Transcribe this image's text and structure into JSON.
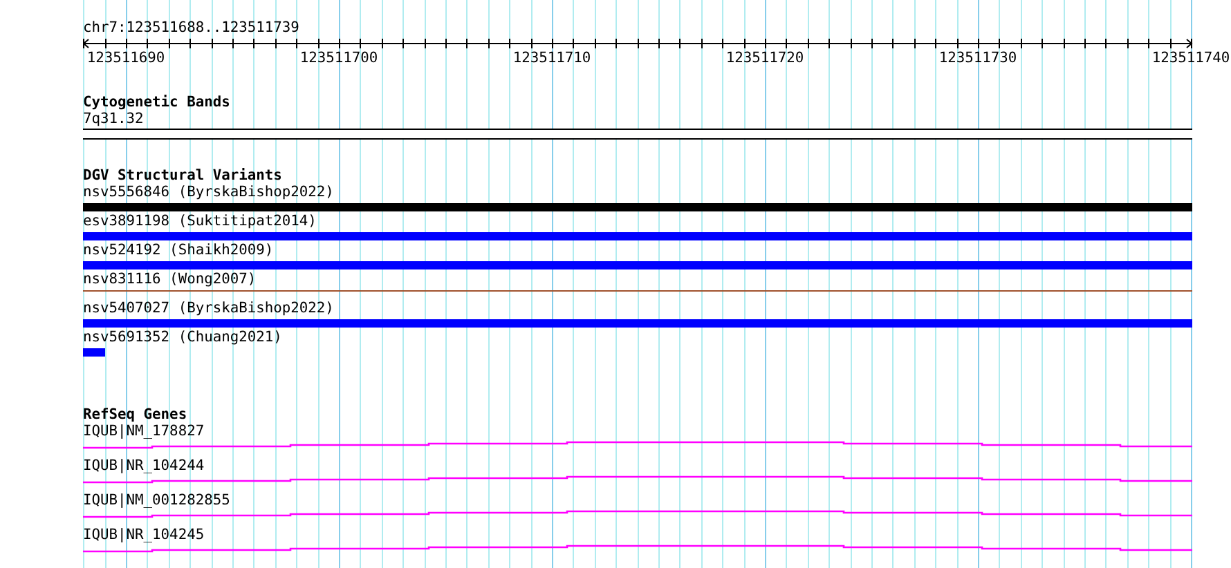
{
  "ruler": {
    "location": "chr7:123511688..123511739",
    "tick_labels": [
      "123511690",
      "123511700",
      "123511710",
      "123511720",
      "123511730",
      "123511740"
    ]
  },
  "tracks": [
    {
      "kind": "cytobands",
      "title": "Cytogenetic Bands",
      "bands": [
        {
          "label": "7q31.32"
        }
      ]
    },
    {
      "kind": "variants",
      "title": "DGV Structural Variants",
      "items": [
        {
          "label": "nsv5556846 (ByrskaBishop2022)",
          "kind": "bar",
          "color": "#000000"
        },
        {
          "label": "esv3891198 (Suktitipat2014)",
          "kind": "bar",
          "color": "#0000ff"
        },
        {
          "label": "nsv524192 (Shaikh2009)",
          "kind": "bar",
          "color": "#0000ff"
        },
        {
          "label": "nsv831116 (Wong2007)",
          "kind": "line",
          "color": "#a0522d"
        },
        {
          "label": "nsv5407027 (ByrskaBishop2022)",
          "kind": "bar",
          "color": "#0000ff"
        },
        {
          "label": "nsv5691352 (Chuang2021)",
          "kind": "fragment",
          "color": "#0000ff"
        }
      ]
    },
    {
      "kind": "genes",
      "title": "RefSeq Genes",
      "items": [
        {
          "label": "IQUB|NM_178827"
        },
        {
          "label": "IQUB|NR_104244"
        },
        {
          "label": "IQUB|NM_001282855"
        },
        {
          "label": "IQUB|NR_104245"
        }
      ]
    }
  ]
}
